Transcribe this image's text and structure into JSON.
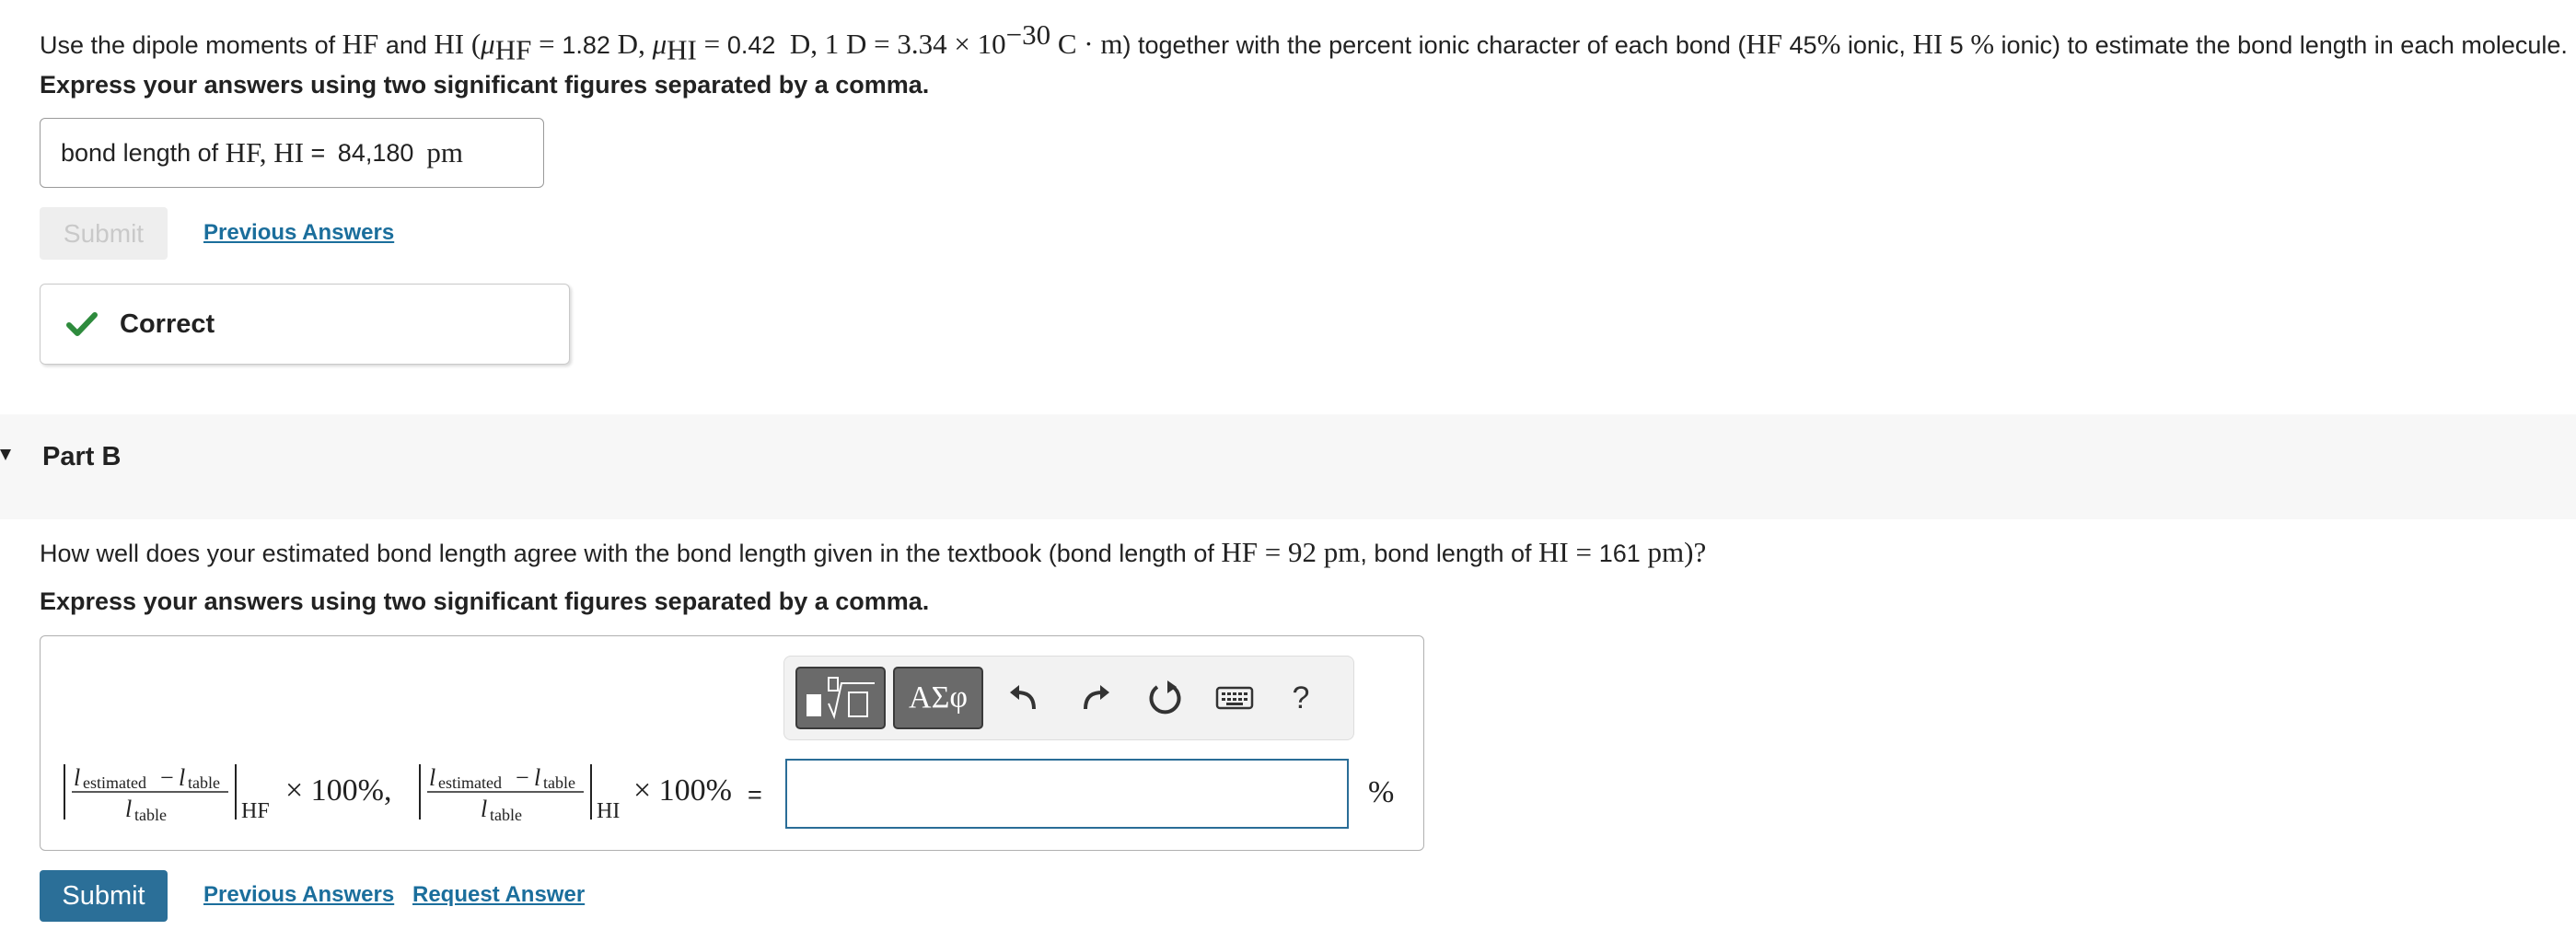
{
  "part_a": {
    "question": {
      "t1": "Use the dipole moments of ",
      "hf": "HF",
      "t2": " and ",
      "hi": "HI",
      "t3": " (",
      "mu": "μ",
      "sub_hf": "HF",
      "eq": " = ",
      "val_hf": "1.82",
      "unit_d": " D",
      "comma": ", ",
      "mu2": "μ",
      "sub_hi": "HI",
      "eq2": " = ",
      "val_hi": "0.42",
      "unit_d2": "  D",
      "comma2": ", ",
      "d_def": "1 D = 3.34 × 10",
      "exp": "−30",
      "cm": " C · m",
      "t4": ") together with the percent ionic character of each bond (",
      "hf2": "HF",
      "pct_hf": " 45",
      "pct_sym": "%",
      "t5": " ionic, ",
      "hi2": "HI",
      "pct_hi": " 5 ",
      "pct_sym2": "%",
      "t6": " ionic) to estimate the bond length in each molecule."
    },
    "instruction": "Express your answers using two significant figures separated by a comma.",
    "answer": {
      "label_prefix": "bond length of ",
      "label_m": "HF, HI",
      "equals": " = ",
      "value": "84,180",
      "unit": "pm"
    },
    "submit_label": "Submit",
    "previous_answers": "Previous Answers",
    "feedback": "Correct",
    "accent_green": "#2e8b3d"
  },
  "part_b": {
    "title": "Part B",
    "question": {
      "t1": "How well does your estimated bond length agree with the bond length given in the textbook (bond length of ",
      "hf": "HF = 92 pm",
      "t2": ", bond length of ",
      "hi": "HI",
      "eq": " = ",
      "val": "161",
      "unit": " pm",
      "t3": ")?"
    },
    "instruction": "Express your answers using two significant figures separated by a comma.",
    "toolbar": {
      "greek_label": "ΑΣφ",
      "help_label": "?"
    },
    "expression": {
      "l_est": "l",
      "sub_est": "estimated",
      "minus": "−",
      "l_tab": "l",
      "sub_tab": "table",
      "sub_hf": "HF",
      "sub_hi": "HI",
      "times": "× 100%,",
      "times2": "× 100%",
      "equals": " ="
    },
    "input_value": "",
    "unit": "%",
    "submit_label": "Submit",
    "previous_answers": "Previous Answers",
    "request_answer": "Request Answer",
    "accent_blue": "#2b6f98"
  }
}
